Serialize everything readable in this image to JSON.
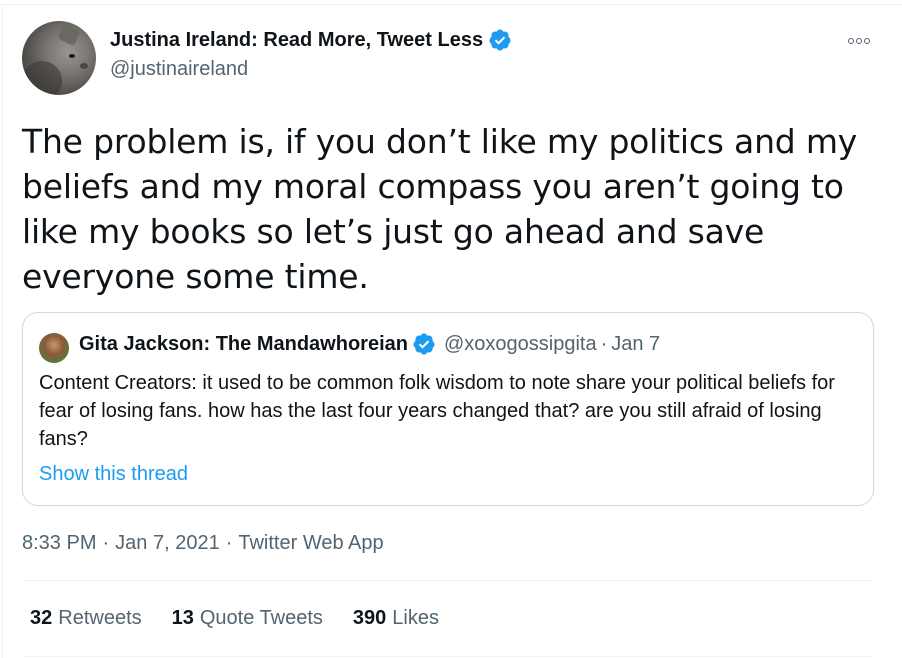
{
  "author": {
    "display_name": "Justina Ireland: Read More, Tweet Less",
    "handle": "@justinaireland",
    "verified": true
  },
  "tweet": {
    "text": "The problem is, if you don’t like my politics and my beliefs and my moral compass you aren’t going to like my books so let’s just go ahead and save everyone some time."
  },
  "quoted_tweet": {
    "display_name": "Gita Jackson: The Mandawhoreian",
    "handle": "@xoxogossipgita",
    "separator": "·",
    "date": "Jan 7",
    "text": "Content Creators: it used to be common folk wisdom to note share your political beliefs for fear of losing fans. how has the last four years changed that? are you still afraid of losing fans?",
    "show_thread": "Show this thread"
  },
  "meta": {
    "time": "8:33 PM",
    "separator": "·",
    "date": "Jan 7, 2021",
    "source": "Twitter Web App"
  },
  "stats": [
    {
      "count": "32",
      "label": "Retweets"
    },
    {
      "count": "13",
      "label": "Quote Tweets"
    },
    {
      "count": "390",
      "label": "Likes"
    }
  ],
  "colors": {
    "verified_blue": "#1d9bf0",
    "secondary_text": "#536471",
    "link": "#1d9bf0"
  },
  "icons": {
    "verified": "verified-badge-icon",
    "more": "more-options-icon"
  }
}
